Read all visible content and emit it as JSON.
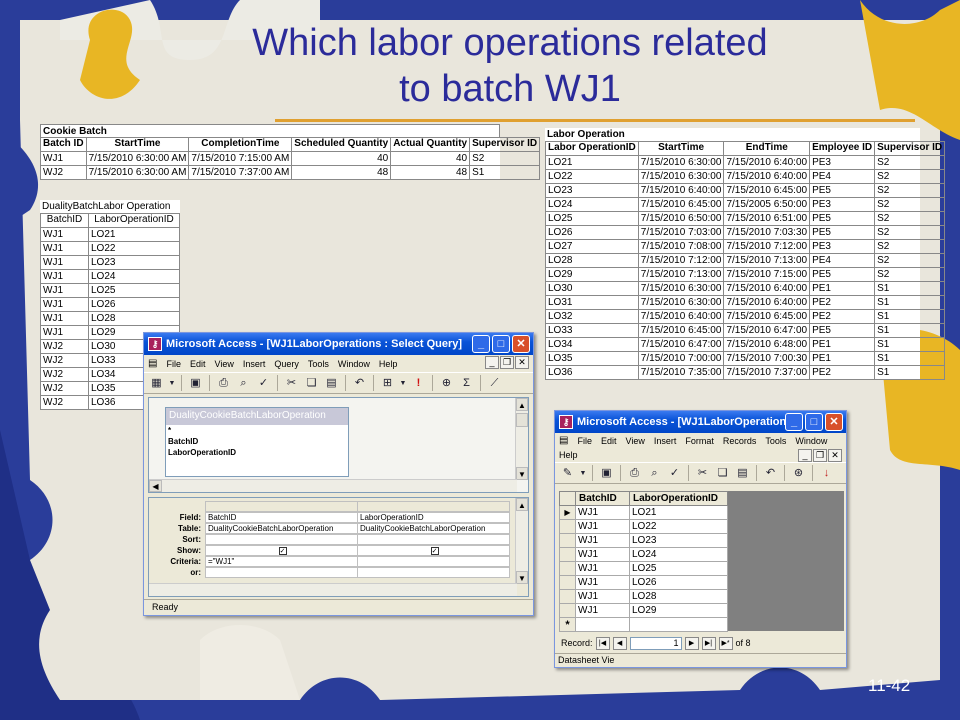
{
  "slide": {
    "title_line1": "Which labor operations related",
    "title_line2": "to batch WJ1",
    "page_number": "11-42"
  },
  "cookie_batch": {
    "caption": "Cookie Batch",
    "headers": [
      "Batch ID",
      "StartTime",
      "CompletionTime",
      "Scheduled Quantity",
      "Actual Quantity",
      "Supervisor ID"
    ],
    "rows": [
      [
        "WJ1",
        "7/15/2010 6:30:00 AM",
        "7/15/2010 7:15:00 AM",
        "40",
        "40",
        "S2"
      ],
      [
        "WJ2",
        "7/15/2010 6:30:00 AM",
        "7/15/2010 7:37:00 AM",
        "48",
        "48",
        "S1"
      ]
    ]
  },
  "duality_table": {
    "caption": "DualityBatchLabor Operation",
    "headers": [
      "BatchID",
      "LaborOperationID"
    ],
    "rows": [
      [
        "WJ1",
        "LO21"
      ],
      [
        "WJ1",
        "LO22"
      ],
      [
        "WJ1",
        "LO23"
      ],
      [
        "WJ1",
        "LO24"
      ],
      [
        "WJ1",
        "LO25"
      ],
      [
        "WJ1",
        "LO26"
      ],
      [
        "WJ1",
        "LO28"
      ],
      [
        "WJ1",
        "LO29"
      ],
      [
        "WJ2",
        "LO30"
      ],
      [
        "WJ2",
        "LO33"
      ],
      [
        "WJ2",
        "LO34"
      ],
      [
        "WJ2",
        "LO35"
      ],
      [
        "WJ2",
        "LO36"
      ]
    ]
  },
  "labor_operation": {
    "caption": "Labor Operation",
    "headers": [
      "Labor OperationID",
      "StartTime",
      "EndTime",
      "Employee ID",
      "Supervisor ID"
    ],
    "rows": [
      [
        "LO21",
        "7/15/2010 6:30:00",
        "7/15/2010 6:40:00",
        "PE3",
        "S2"
      ],
      [
        "LO22",
        "7/15/2010 6:30:00",
        "7/15/2010 6:40:00",
        "PE4",
        "S2"
      ],
      [
        "LO23",
        "7/15/2010 6:40:00",
        "7/15/2010 6:45:00",
        "PE5",
        "S2"
      ],
      [
        "LO24",
        "7/15/2010 6:45:00",
        "7/15/2005 6:50:00",
        "PE3",
        "S2"
      ],
      [
        "LO25",
        "7/15/2010 6:50:00",
        "7/15/2010 6:51:00",
        "PE5",
        "S2"
      ],
      [
        "LO26",
        "7/15/2010 7:03:00",
        "7/15/2010 7:03:30",
        "PE5",
        "S2"
      ],
      [
        "LO27",
        "7/15/2010 7:08:00",
        "7/15/2010 7:12:00",
        "PE3",
        "S2"
      ],
      [
        "LO28",
        "7/15/2010 7:12:00",
        "7/15/2010 7:13:00",
        "PE4",
        "S2"
      ],
      [
        "LO29",
        "7/15/2010 7:13:00",
        "7/15/2010 7:15:00",
        "PE5",
        "S2"
      ],
      [
        "LO30",
        "7/15/2010 6:30:00",
        "7/15/2010 6:40:00",
        "PE1",
        "S1"
      ],
      [
        "LO31",
        "7/15/2010 6:30:00",
        "7/15/2010 6:40:00",
        "PE2",
        "S1"
      ],
      [
        "LO32",
        "7/15/2010 6:40:00",
        "7/15/2010 6:45:00",
        "PE2",
        "S1"
      ],
      [
        "LO33",
        "7/15/2010 6:45:00",
        "7/15/2010 6:47:00",
        "PE5",
        "S1"
      ],
      [
        "LO34",
        "7/15/2010 6:47:00",
        "7/15/2010 6:48:00",
        "PE1",
        "S1"
      ],
      [
        "LO35",
        "7/15/2010 7:00:00",
        "7/15/2010 7:00:30",
        "PE1",
        "S1"
      ],
      [
        "LO36",
        "7/15/2010 7:35:00",
        "7/15/2010 7:37:00",
        "PE2",
        "S1"
      ]
    ]
  },
  "query_window": {
    "title": "Microsoft Access - [WJ1LaborOperations : Select Query]",
    "menu": [
      "File",
      "Edit",
      "View",
      "Insert",
      "Query",
      "Tools",
      "Window",
      "Help"
    ],
    "field_list_title": "DualityCookieBatchLaborOperation",
    "field_list_items": [
      "*",
      "BatchID",
      "LaborOperationID"
    ],
    "grid_labels": [
      "Field:",
      "Table:",
      "Sort:",
      "Show:",
      "Criteria:",
      "or:"
    ],
    "columns": [
      {
        "field": "BatchID",
        "table": "DualityCookieBatchLaborOperation",
        "criteria": "=\"WJ1\""
      },
      {
        "field": "LaborOperationID",
        "table": "DualityCookieBatchLaborOperation",
        "criteria": ""
      }
    ],
    "status": "Ready",
    "icons": [
      "datasheet-view-icon",
      "save-icon",
      "print-icon",
      "print-preview-icon",
      "spelling-icon",
      "cut-icon",
      "copy-icon",
      "paste-icon",
      "undo-icon",
      "query-type-icon",
      "run-icon",
      "show-table-icon",
      "totals-icon",
      "build-icon"
    ]
  },
  "result_window": {
    "title": "Microsoft Access - [WJ1LaborOperations...",
    "menu": [
      "File",
      "Edit",
      "View",
      "Insert",
      "Format",
      "Records",
      "Tools",
      "Window",
      "Help"
    ],
    "headers": [
      "BatchID",
      "LaborOperationID"
    ],
    "rows": [
      [
        "WJ1",
        "LO21"
      ],
      [
        "WJ1",
        "LO22"
      ],
      [
        "WJ1",
        "LO23"
      ],
      [
        "WJ1",
        "LO24"
      ],
      [
        "WJ1",
        "LO25"
      ],
      [
        "WJ1",
        "LO26"
      ],
      [
        "WJ1",
        "LO28"
      ],
      [
        "WJ1",
        "LO29"
      ]
    ],
    "new_row_marker": "*",
    "record_label": "Record:",
    "record_value": "1",
    "record_of": "of 8",
    "status": "Datasheet Vie"
  },
  "colors": {
    "background": "#2a3d9a",
    "puzzle": "#e9e6dc",
    "title": "#2b2b9a",
    "rule": "#e0a030",
    "titlebar": "#0a54d8",
    "puzzle_yellow": "#e8b624"
  }
}
